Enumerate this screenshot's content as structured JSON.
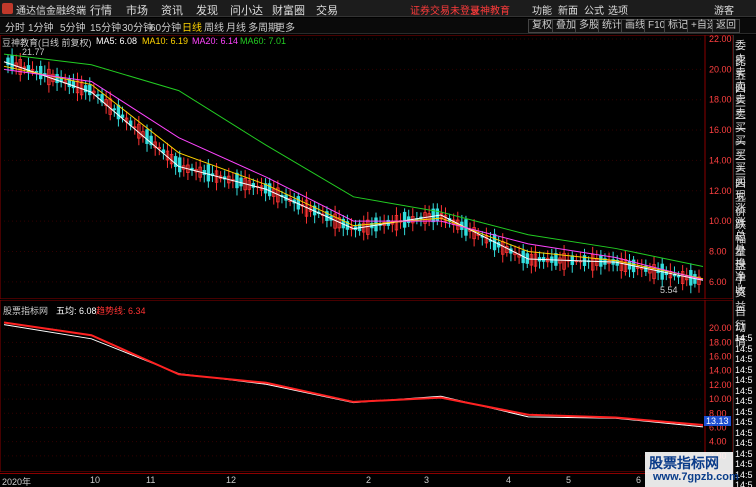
{
  "titlebar": {
    "app_name": "通达信金融终端",
    "menu": [
      "行情",
      "市场",
      "资讯",
      "发现",
      "问小达",
      "财富圈",
      "交易"
    ],
    "login_notice": "证券交易未登录",
    "brand_link": "豆神教育",
    "right_items": [
      "功能",
      "新面",
      "公式",
      "选项",
      "游客"
    ]
  },
  "toolbar": {
    "periods": [
      "分时",
      "1分钟",
      "5分钟",
      "15分钟",
      "30分钟",
      "60分钟",
      "日线",
      "周线",
      "月线",
      "多周期",
      "更多"
    ],
    "active_period": "日线",
    "buttons": [
      "复权",
      "叠加",
      "多股",
      "统计",
      "画线",
      "F10",
      "标记",
      "+自选",
      "返回"
    ]
  },
  "main_chart": {
    "stock_label": "豆神教育(日线 前复权)",
    "ma5_label": "MA5: 6.08",
    "ma10_label": "MA10: 6.19",
    "ma20_label": "MA20: 6.14",
    "ma60_label": "MA60: 7.01",
    "high_annotation": "21.77",
    "low_annotation": "5.54",
    "colors": {
      "ma5": "#ffffff",
      "ma10": "#ffd400",
      "ma20": "#ff44ff",
      "ma60": "#22cc22",
      "up": "#ff3333",
      "down": "#33dddd"
    }
  },
  "sub_chart": {
    "indicator_name": "股票指标网",
    "line1_label": "五均: 6.08",
    "line2_label": "趋势线: 6.34",
    "price_badge": "13.13"
  },
  "right_panel": {
    "items": [
      "委比",
      "卖五",
      "卖四",
      "卖三",
      "卖二",
      "卖一",
      "买一",
      "买二",
      "买三",
      "买四",
      "买五",
      "现价",
      "涨跌",
      "涨幅",
      "总量",
      "外盘",
      "换手",
      "净资",
      "收益"
    ],
    "lower_items": [
      "自动",
      "行情"
    ],
    "times": [
      "14:5",
      "14:5",
      "14:5",
      "14:5",
      "14:5",
      "14:5",
      "14:5",
      "14:5",
      "14:5",
      "14:5",
      "14:5",
      "14:5",
      "14:5",
      "14:5",
      "14:5"
    ]
  },
  "x_axis": {
    "labels": [
      "2020年",
      "10",
      "11",
      "12",
      "2",
      "3",
      "4",
      "5",
      "6"
    ]
  },
  "watermark": {
    "title": "股票指标网",
    "url": "www.7gpzb.com"
  },
  "chart_data": {
    "type": "line",
    "title": "豆神教育(日线 前复权)",
    "xlabel": "",
    "ylabel": "",
    "ylim": [
      5,
      22
    ],
    "y_ticks": [
      "22.00",
      "20.00",
      "18.00",
      "16.00",
      "14.00",
      "12.00",
      "10.00",
      "8.00",
      "6.00"
    ],
    "x": [
      "2020年",
      "10",
      "11",
      "12",
      "2",
      "3",
      "4",
      "5",
      "6"
    ],
    "series": [
      {
        "name": "MA5",
        "values": [
          20.5,
          18.5,
          13.6,
          12.1,
          9.5,
          10.4,
          7.5,
          7.3,
          6.1
        ]
      },
      {
        "name": "MA10",
        "values": [
          20.2,
          19.0,
          14.5,
          12.4,
          9.7,
          10.2,
          8.0,
          7.4,
          6.2
        ]
      },
      {
        "name": "MA20",
        "values": [
          20.0,
          19.2,
          15.5,
          12.9,
          10.0,
          10.0,
          8.5,
          7.6,
          6.14
        ]
      },
      {
        "name": "MA60",
        "values": [
          21.0,
          20.3,
          18.6,
          15.0,
          11.6,
          10.6,
          9.1,
          8.2,
          7.01
        ]
      }
    ],
    "sub_chart": {
      "ylim": [
        0,
        22
      ],
      "y_ticks": [
        "20.00",
        "18.00",
        "16.00",
        "14.00",
        "12.00",
        "10.00",
        "8.00",
        "6.00",
        "4.00",
        "2.00"
      ],
      "series": [
        {
          "name": "五均",
          "values": [
            20.5,
            18.5,
            13.6,
            12.1,
            9.5,
            10.4,
            7.5,
            7.3,
            6.08
          ]
        },
        {
          "name": "趋势线",
          "values": [
            20.8,
            19.0,
            13.5,
            12.3,
            9.6,
            10.2,
            7.8,
            7.4,
            6.34
          ]
        }
      ]
    }
  }
}
